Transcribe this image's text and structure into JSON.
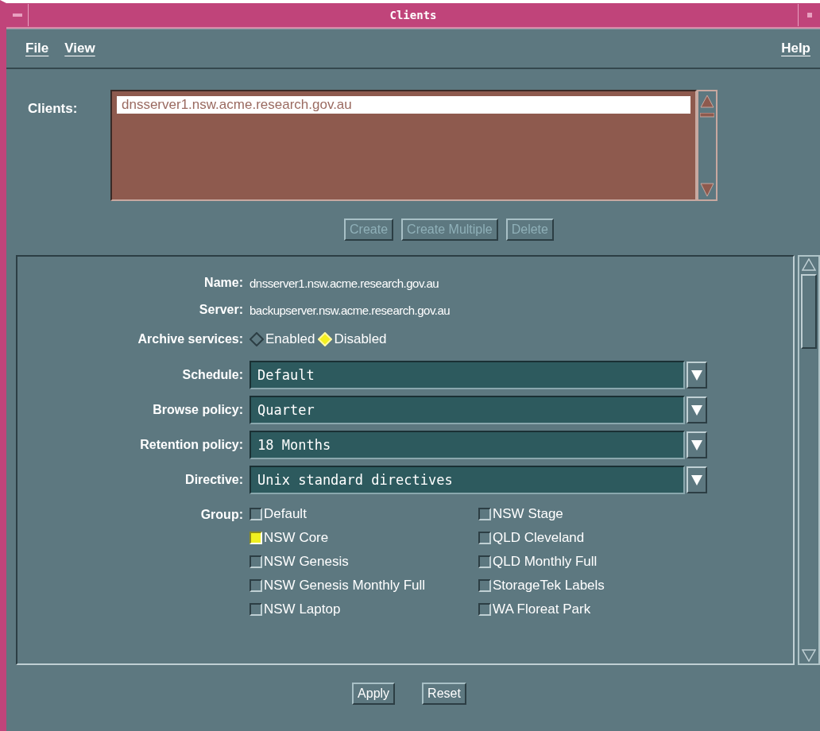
{
  "window": {
    "title": "Clients"
  },
  "menu": [
    {
      "label": "File"
    },
    {
      "label": "View"
    }
  ],
  "help_menu": {
    "label": "Help"
  },
  "clients": {
    "label": "Clients:",
    "items": [
      {
        "text": "dnsserver1.nsw.acme.research.gov.au",
        "selected": true
      }
    ]
  },
  "list_buttons": [
    {
      "label": "Create",
      "disabled": true
    },
    {
      "label": "Create Multiple",
      "disabled": true
    },
    {
      "label": "Delete",
      "disabled": true
    }
  ],
  "details": {
    "name": {
      "label": "Name:",
      "value": "dnsserver1.nsw.acme.research.gov.au"
    },
    "server": {
      "label": "Server:",
      "value": "backupserver.nsw.acme.research.gov.au"
    },
    "archive": {
      "label": "Archive services:",
      "options": [
        {
          "label": "Enabled",
          "selected": false
        },
        {
          "label": "Disabled",
          "selected": true
        }
      ]
    },
    "combos": [
      {
        "label": "Schedule:",
        "value": "Default"
      },
      {
        "label": "Browse policy:",
        "value": "Quarter"
      },
      {
        "label": "Retention policy:",
        "value": "18 Months"
      },
      {
        "label": "Directive:",
        "value": "Unix standard directives"
      }
    ],
    "group": {
      "label": "Group:",
      "items": [
        {
          "label": "Default",
          "checked": false
        },
        {
          "label": "NSW Stage",
          "checked": false
        },
        {
          "label": "NSW Core",
          "checked": true
        },
        {
          "label": "QLD Cleveland",
          "checked": false
        },
        {
          "label": "NSW Genesis",
          "checked": false
        },
        {
          "label": "QLD Monthly Full",
          "checked": false
        },
        {
          "label": "NSW Genesis Monthly Full",
          "checked": false
        },
        {
          "label": "StorageTek Labels",
          "checked": false
        },
        {
          "label": "NSW Laptop",
          "checked": false
        },
        {
          "label": "WA Floreat Park",
          "checked": false
        }
      ]
    }
  },
  "buttons": [
    {
      "label": "Apply",
      "disabled": false
    },
    {
      "label": "Reset",
      "disabled": false
    }
  ]
}
